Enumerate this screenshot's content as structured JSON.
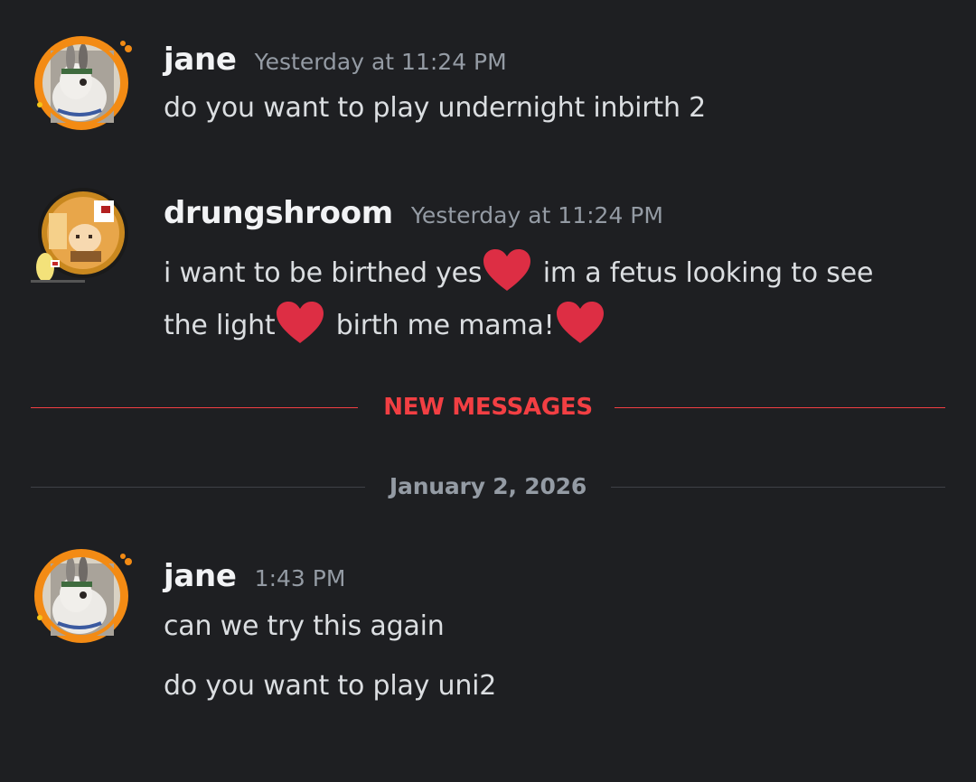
{
  "messages": [
    {
      "username": "jane",
      "timestamp": "Yesterday at 11:24 PM",
      "avatar": "rabbit-avatar",
      "lines": [
        "do you want to play undernight inbirth 2"
      ]
    },
    {
      "username": "drungshroom",
      "timestamp": "Yesterday at 11:24 PM",
      "avatar": "pixel-art-avatar",
      "line1_a": "i want to be birthed yes",
      "line1_b": " im a fetus looking to see",
      "line2_a": "the light",
      "line2_b": " birth me mama!"
    },
    {
      "username": "jane",
      "timestamp": "1:43 PM",
      "avatar": "rabbit-avatar",
      "lines": [
        "can we try this again",
        "do you want to play uni2"
      ]
    }
  ],
  "new_messages_divider": "NEW MESSAGES",
  "date_divider": "January 2, 2026",
  "colors": {
    "background": "#1e1f22",
    "new_messages": "#f23f43",
    "heart": "#dd2e44",
    "avatar_ring": "#f38b14"
  },
  "emoji": "red-heart-emoji"
}
